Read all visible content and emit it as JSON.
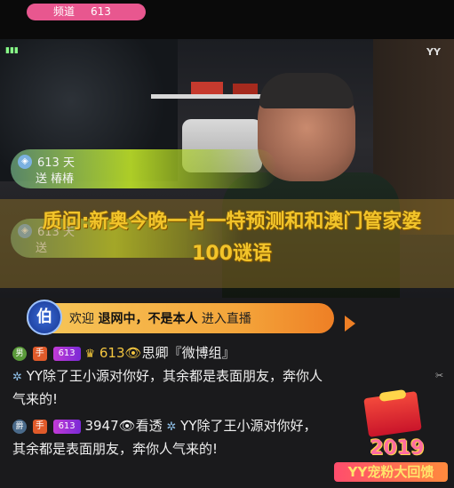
{
  "channel": {
    "label": "频道",
    "number": "613"
  },
  "watermark": "YY",
  "gift_banners": [
    {
      "line1": "613 天",
      "line2": "送 椿椿"
    },
    {
      "line1": "613 天",
      "line2": "送"
    }
  ],
  "headline": "质问:新奥今晚一肖一特预测和和澳门管家婆100谜语",
  "welcome": {
    "avatar_char": "伯",
    "prefix": "欢迎",
    "name": "退网中，不是本人",
    "suffix": "进入直播"
  },
  "messages": [
    {
      "noble": "男",
      "hand": "手",
      "level": "613",
      "crown_value": "613",
      "user": "思卿『微博组』",
      "text": "YY除了王小源对你好，其余都是表面朋友，奔你人气来的!"
    },
    {
      "noble": "爵",
      "hand": "手",
      "level": "613",
      "crown_value": "3947",
      "user": "看透",
      "text": "YY除了王小源对你好，其余都是表面朋友，奔你人气来的!"
    }
  ],
  "promo": {
    "year": "2019",
    "title": "YY宠粉大回馈"
  },
  "colors": {
    "channel_pill": "#e8578f",
    "headline": "#f2c42a",
    "welcome_bar": "#f6c85a",
    "level_badge": "#a232d6"
  }
}
